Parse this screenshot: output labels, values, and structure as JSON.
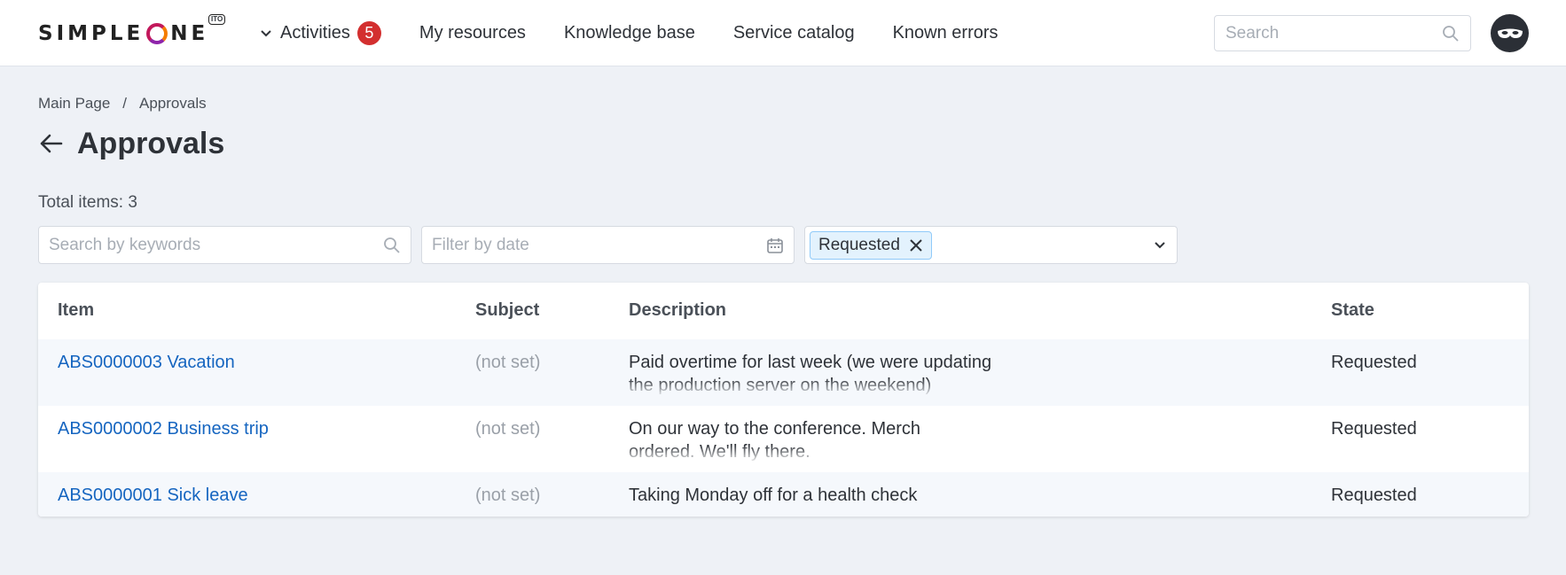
{
  "header": {
    "logo_text_before": "SIMPLE",
    "logo_text_after": "NE",
    "logo_badge": "ITO",
    "nav": [
      {
        "label": "Activities",
        "badge": "5",
        "has_dropdown": true
      },
      {
        "label": "My resources"
      },
      {
        "label": "Knowledge base"
      },
      {
        "label": "Service catalog"
      },
      {
        "label": "Known errors"
      }
    ],
    "search_placeholder": "Search",
    "search_icon": "search-icon",
    "avatar_icon": "mask-avatar-icon"
  },
  "breadcrumb": {
    "items": [
      "Main Page",
      "Approvals"
    ],
    "separator": "/"
  },
  "page": {
    "title": "Approvals",
    "back_icon": "arrow-left-icon",
    "total_label": "Total items: 3"
  },
  "filters": {
    "keyword_placeholder": "Search by keywords",
    "date_placeholder": "Filter by date",
    "state_chip": "Requested"
  },
  "table": {
    "columns": [
      "Item",
      "Subject",
      "Description",
      "State"
    ],
    "rows": [
      {
        "item": "ABS0000003 Vacation",
        "subject": "(not set)",
        "description": "Paid overtime for last week (we were updating the production server on the weekend)",
        "state": "Requested"
      },
      {
        "item": "ABS0000002 Business trip",
        "subject": "(not set)",
        "description": "On our way to the conference. Merch ordered. We'll fly there.",
        "state": "Requested"
      },
      {
        "item": "ABS0000001 Sick leave",
        "subject": "(not set)",
        "description": "Taking Monday off for a health check",
        "state": "Requested"
      }
    ]
  },
  "colors": {
    "background": "#eef1f6",
    "link": "#1565c0",
    "badge": "#d32f2f",
    "chip_bg": "#e3f2fd",
    "chip_border": "#90caf9"
  }
}
